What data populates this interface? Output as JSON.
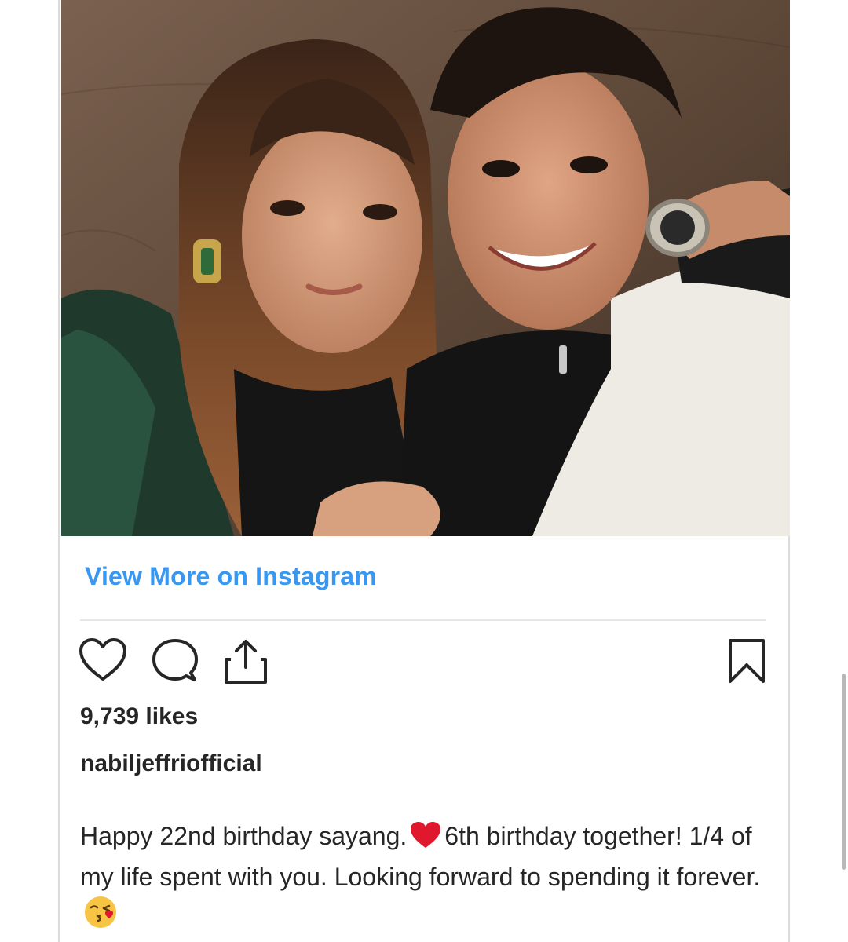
{
  "post": {
    "photo_icon": "couple-selfie-photo",
    "view_more_label": "View More on Instagram",
    "likes": "9,739 likes",
    "username": "nabiljeffriofficial",
    "caption": {
      "part1": "Happy 22nd birthday sayang.",
      "emoji1": "red-heart-emoji",
      "part2": "6th birthday together! 1/4 of my life spent with you. Looking forward to spending it forever.",
      "emoji2": "face-blowing-kiss-emoji"
    }
  },
  "actions": {
    "like_icon": "heart-icon",
    "comment_icon": "comment-icon",
    "share_icon": "share-icon",
    "save_icon": "bookmark-icon"
  },
  "colors": {
    "link": "#3897f0",
    "text": "#262626",
    "border": "#dbdbdb",
    "heart_emoji": "#e0182d"
  }
}
